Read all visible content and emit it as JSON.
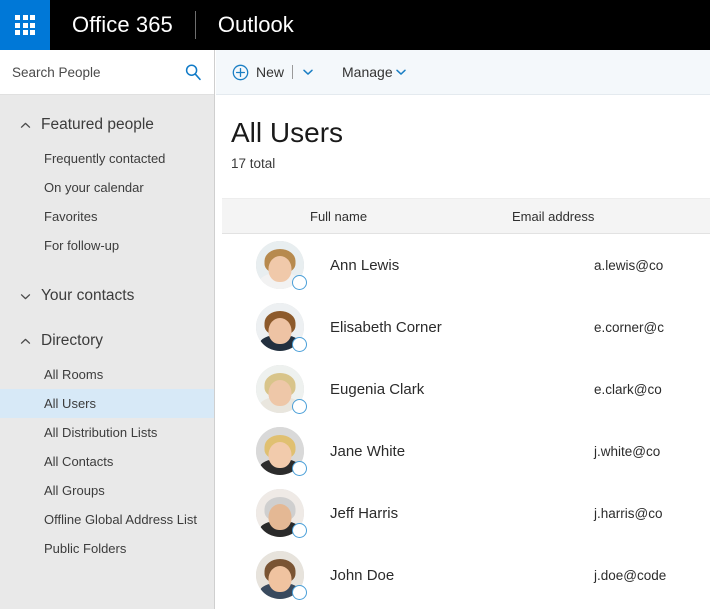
{
  "suite": {
    "app_launcher": "app-launcher",
    "brand": "Office 365",
    "app_name": "Outlook"
  },
  "search": {
    "placeholder": "Search People",
    "value": ""
  },
  "sidebar": {
    "sections": [
      {
        "label": "Featured people",
        "expanded": true,
        "chevron": "chevron-up-icon",
        "items": [
          {
            "label": "Frequently contacted",
            "selected": false
          },
          {
            "label": "On your calendar",
            "selected": false
          },
          {
            "label": "Favorites",
            "selected": false
          },
          {
            "label": "For follow-up",
            "selected": false
          }
        ]
      },
      {
        "label": "Your contacts",
        "expanded": false,
        "chevron": "chevron-down-icon",
        "items": []
      },
      {
        "label": "Directory",
        "expanded": true,
        "chevron": "chevron-up-icon",
        "items": [
          {
            "label": "All Rooms",
            "selected": false
          },
          {
            "label": "All Users",
            "selected": true
          },
          {
            "label": "All Distribution Lists",
            "selected": false
          },
          {
            "label": "All Contacts",
            "selected": false
          },
          {
            "label": "All Groups",
            "selected": false
          },
          {
            "label": "Offline Global Address List",
            "selected": false
          },
          {
            "label": "Public Folders",
            "selected": false
          }
        ]
      }
    ]
  },
  "toolbar": {
    "new_label": "New",
    "new_icon": "plus-circle-icon",
    "new_caret": "chevron-down-icon",
    "manage_label": "Manage",
    "manage_caret": "chevron-down-icon"
  },
  "main": {
    "title": "All Users",
    "subtitle": "17 total",
    "columns": {
      "full_name": "Full name",
      "email_address": "Email address"
    },
    "rows": [
      {
        "full_name": "Ann Lewis",
        "email": "a.lewis@co",
        "presence": "available-outline",
        "skin": "#f0c9aa",
        "hair": "#b78a4e",
        "bg": "#e8eef0",
        "body": "#f2f2f2"
      },
      {
        "full_name": "Elisabeth Corner",
        "email": "e.corner@c",
        "presence": "available-outline",
        "skin": "#eec3a4",
        "hair": "#8d5a2b",
        "bg": "#edf0f2",
        "body": "#23303f"
      },
      {
        "full_name": "Eugenia Clark",
        "email": "e.clark@co",
        "presence": "available-outline",
        "skin": "#eec7a8",
        "hair": "#d8c48a",
        "bg": "#eef1ef",
        "body": "#e9e6de"
      },
      {
        "full_name": "Jane White",
        "email": "j.white@co",
        "presence": "available-outline",
        "skin": "#f2cbac",
        "hair": "#e0c071",
        "bg": "#d9d9d9",
        "body": "#2c2c2c"
      },
      {
        "full_name": "Jeff Harris",
        "email": "j.harris@co",
        "presence": "available-outline",
        "skin": "#e4b894",
        "hair": "#cfcfcf",
        "bg": "#efeae6",
        "body": "#2a2a2a"
      },
      {
        "full_name": "John Doe",
        "email": "j.doe@code",
        "presence": "available-outline",
        "skin": "#f0c3a0",
        "hair": "#7a5433",
        "bg": "#e7e3dc",
        "body": "#394a5e"
      }
    ]
  },
  "colors": {
    "accent": "#0078d7",
    "suitebar": "#000000",
    "sidebar_bg": "#e9e9e9",
    "selected_nav": "#d7e9f7",
    "toolbar_bg": "#f4f8fb",
    "table_header_bg": "#f4f4f4"
  }
}
